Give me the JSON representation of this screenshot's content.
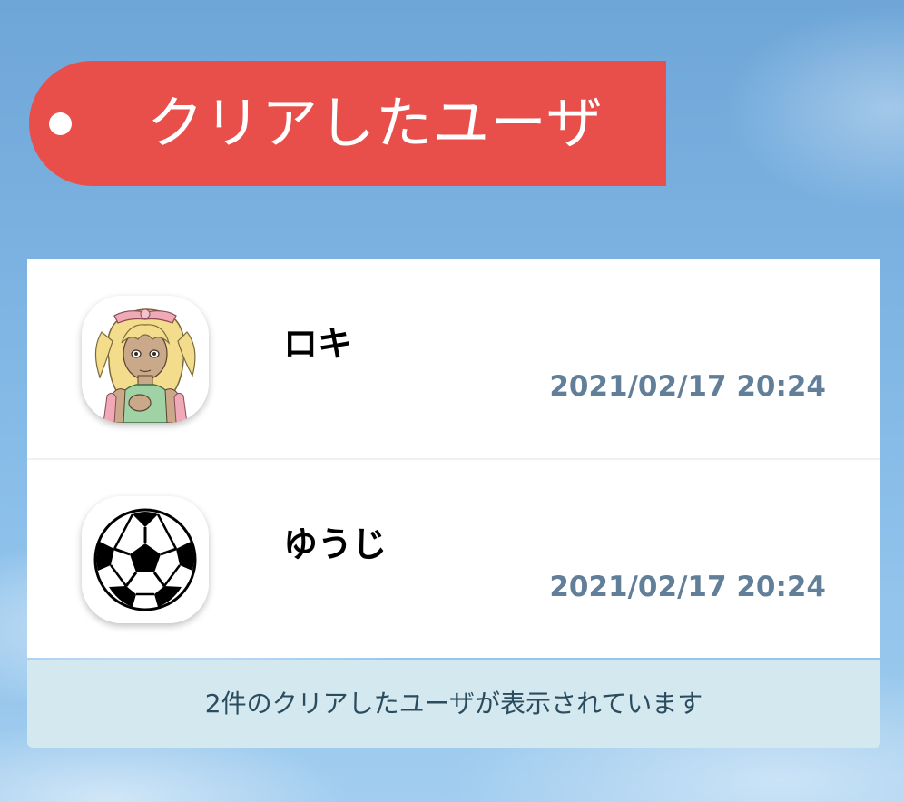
{
  "header": {
    "title": "クリアしたユーザ"
  },
  "cleared_users": [
    {
      "name": "ロキ",
      "cleared_at": "2021/02/17 20:24",
      "avatar_icon": "anime-girl-avatar"
    },
    {
      "name": "ゆうじ",
      "cleared_at": "2021/02/17 20:24",
      "avatar_icon": "soccer-ball-avatar"
    }
  ],
  "footer": {
    "summary": "2件のクリアしたユーザが表示されています"
  },
  "colors": {
    "banner": "#e84f4a",
    "timestamp": "#627f99",
    "footer_bg": "#d4e8ef",
    "footer_text": "#2a4c5e"
  }
}
